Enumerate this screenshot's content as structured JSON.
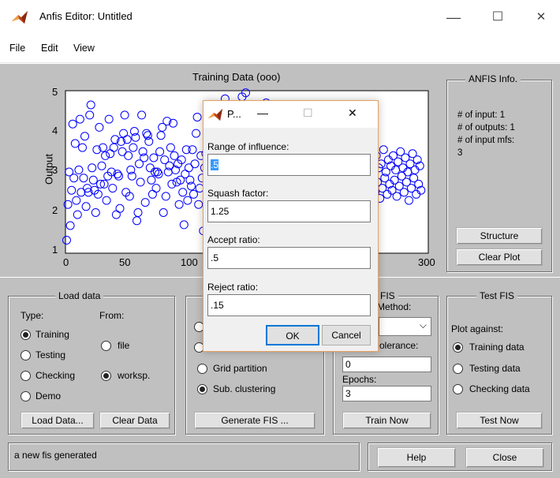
{
  "window": {
    "title": "Anfis Editor: Untitled",
    "minimize": "—",
    "maximize": "☐",
    "close": "✕"
  },
  "menu": {
    "items": [
      "File",
      "Edit",
      "View"
    ]
  },
  "plot": {
    "title": "Training Data (ooo)",
    "ylabel": "Output",
    "xticks": [
      "0",
      "50",
      "100",
      "300"
    ],
    "yticks": [
      "1",
      "2",
      "3",
      "4",
      "5"
    ]
  },
  "chart_data": {
    "type": "scatter",
    "title": "Training Data (ooo)",
    "xlabel": "",
    "ylabel": "Output",
    "xlim": [
      0,
      300
    ],
    "ylim": [
      1,
      5
    ],
    "marker": "o",
    "color": "#0000ff",
    "x": [
      1,
      2,
      3,
      4,
      5,
      6,
      7,
      8,
      9,
      10,
      11,
      12,
      13,
      14,
      15,
      16,
      17,
      18,
      19,
      20,
      21,
      22,
      23,
      24,
      25,
      26,
      27,
      28,
      29,
      30,
      31,
      32,
      33,
      34,
      35,
      36,
      37,
      38,
      39,
      40,
      41,
      42,
      43,
      44,
      45,
      46,
      47,
      48,
      49,
      50,
      51,
      52,
      53,
      54,
      55,
      56,
      57,
      58,
      59,
      60,
      61,
      62,
      63,
      64,
      65,
      66,
      67,
      68,
      69,
      70,
      71,
      72,
      73,
      74,
      75,
      76,
      77,
      78,
      79,
      80,
      81,
      82,
      83,
      84,
      85,
      86,
      87,
      88,
      89,
      90,
      91,
      92,
      93,
      94,
      95,
      96,
      97,
      98,
      99,
      100,
      101,
      102,
      103,
      104,
      105,
      106,
      107,
      108,
      109,
      110,
      111,
      112,
      113,
      114,
      115,
      116,
      117,
      118,
      119,
      120,
      121,
      122,
      123,
      124,
      125,
      126,
      127,
      128,
      129,
      130,
      131,
      132,
      133,
      134,
      135,
      136,
      137,
      138,
      139,
      140,
      141,
      142,
      143,
      144,
      145,
      146,
      147,
      148,
      149,
      150,
      151,
      152,
      153,
      154,
      155,
      156,
      157,
      158,
      159,
      160,
      161,
      162,
      163,
      164,
      165,
      166,
      167,
      168,
      169,
      170,
      171,
      172,
      173,
      174,
      175,
      176,
      177,
      178,
      179,
      180,
      181,
      182,
      183,
      184,
      185,
      186,
      187,
      188,
      189,
      190,
      191,
      192,
      193,
      194,
      195,
      196,
      197,
      198,
      199,
      200,
      201,
      202,
      203,
      204,
      205,
      206,
      207,
      208,
      209,
      210,
      211,
      212,
      213,
      214,
      215,
      216,
      217,
      218,
      219,
      220,
      221,
      222,
      223,
      224,
      225,
      226,
      227,
      228,
      229,
      230,
      231,
      232,
      233,
      234,
      235,
      236,
      237,
      238,
      239,
      240,
      241,
      242,
      243,
      244,
      245,
      246,
      247,
      248,
      249,
      250,
      251,
      252,
      253,
      254,
      255,
      256,
      257,
      258,
      259,
      260,
      261,
      262,
      263,
      264,
      265,
      266,
      267,
      268,
      269,
      270,
      271,
      272,
      273,
      274,
      275,
      276,
      277,
      278,
      279,
      280,
      281,
      282,
      283,
      284,
      285,
      286,
      287,
      288,
      289,
      290,
      291,
      292,
      293,
      294,
      295,
      296,
      297,
      298,
      299,
      300
    ],
    "y": [
      1.32,
      2.2,
      3.0,
      1.68,
      2.55,
      4.18,
      2.85,
      3.7,
      2.3,
      1.95,
      3.05,
      4.3,
      2.5,
      3.6,
      2.85,
      3.88,
      2.15,
      2.6,
      2.5,
      4.4,
      4.65,
      3.1,
      2.8,
      2.55,
      2.0,
      3.55,
      2.45,
      4.1,
      2.7,
      3.15,
      3.6,
      2.7,
      3.4,
      2.3,
      2.9,
      4.3,
      3.45,
      3.0,
      2.6,
      3.6,
      3.8,
      1.95,
      2.95,
      2.9,
      2.1,
      3.75,
      3.5,
      3.95,
      4.4,
      2.5,
      3.8,
      3.4,
      2.4,
      3.05,
      2.9,
      3.6,
      4.0,
      3.85,
      1.8,
      2.0,
      3.2,
      2.75,
      4.4,
      3.5,
      3.35,
      2.25,
      3.95,
      3.9,
      3.75,
      3.1,
      2.8,
      2.45,
      3.35,
      3.0,
      2.6,
      3.0,
      2.95,
      3.5,
      3.9,
      4.1,
      2.0,
      3.3,
      2.4,
      4.25,
      3.0,
      3.15,
      3.6,
      2.7,
      4.2,
      3.4,
      3.05,
      2.75,
      3.2,
      2.2,
      2.8,
      3.3,
      2.5,
      1.7,
      2.95,
      3.55,
      2.3,
      3.1,
      2.8,
      2.65,
      3.55,
      2.45,
      3.2,
      3.95,
      4.35,
      2.2,
      2.6,
      3.4,
      2.85,
      1.55,
      3.1,
      3.45,
      2.35,
      4.5,
      2.9,
      3.2,
      3.75,
      2.55,
      3.0,
      1.6,
      3.65,
      4.45,
      2.75,
      3.05,
      2.25,
      3.9,
      3.35,
      4.8,
      2.45,
      4.3,
      3.6,
      3.1,
      2.0,
      4.6,
      3.8,
      3.25,
      2.7,
      4.1,
      1.75,
      3.5,
      3.0,
      4.85,
      2.5,
      3.7,
      4.95,
      4.2,
      2.85,
      3.4,
      3.95,
      3.2,
      2.35,
      4.55,
      3.75,
      2.95,
      3.6,
      3.3,
      4.0,
      2.65,
      3.85,
      2.2,
      3.1,
      4.7,
      3.45,
      2.8,
      3.25,
      3.0,
      3.55,
      2.75,
      3.15,
      2.4,
      3.9,
      2.9,
      3.35,
      2.6,
      3.7,
      3.05,
      2.5,
      3.25,
      2.1,
      3.45,
      2.85,
      3.6,
      2.3,
      3.0,
      3.8,
      2.55,
      3.2,
      2.7,
      3.5,
      2.95,
      3.35,
      2.45,
      3.1,
      2.8,
      3.65,
      2.25,
      3.0,
      2.65,
      3.4,
      2.9,
      3.15,
      2.5,
      3.55,
      2.75,
      3.05,
      2.35,
      3.3,
      2.6,
      3.75,
      2.85,
      3.2,
      2.45,
      3.5,
      2.95,
      3.1,
      2.7,
      3.35,
      2.55,
      3.0,
      2.8,
      3.45,
      2.4,
      3.15,
      2.65,
      3.6,
      2.9,
      3.25,
      2.5,
      3.4,
      2.75,
      3.05,
      2.3,
      3.2,
      2.6,
      3.5,
      2.85,
      3.1,
      2.45,
      3.35,
      2.7,
      3.0,
      2.55,
      3.3,
      2.8,
      3.15,
      2.4,
      3.45,
      2.65,
      3.05,
      2.9,
      3.25,
      2.5,
      3.4,
      2.75,
      3.1,
      2.35,
      3.2,
      2.6,
      3.55,
      2.85,
      3.0,
      2.45,
      3.3,
      2.7,
      3.15,
      2.55,
      3.4,
      2.8,
      3.05,
      2.4,
      3.25,
      2.65,
      3.5,
      2.9,
      3.1,
      2.5,
      3.35,
      2.75,
      3.0,
      2.3,
      3.2,
      2.6,
      3.45,
      2.85,
      3.05,
      2.45,
      3.3,
      2.7,
      3.15,
      2.55
    ],
    "visible_x_max": 118
  },
  "anfis_info": {
    "title": "ANFIS Info.",
    "lines": [
      "# of input: 1",
      "# of outputs: 1",
      "# of input mfs:",
      "3"
    ],
    "structure_button": "Structure",
    "clear_plot_button": "Clear Plot"
  },
  "load_data": {
    "title": "Load data",
    "type_label": "Type:",
    "from_label": "From:",
    "types": [
      "Training",
      "Testing",
      "Checking",
      "Demo"
    ],
    "type_selected": 0,
    "sources": [
      "file",
      "worksp."
    ],
    "source_selected": 1,
    "load_button": "Load Data...",
    "clear_button": "Clear Data"
  },
  "generate_fis": {
    "options_visible": [
      "Grid partition",
      "Sub. clustering"
    ],
    "selected": 1,
    "button": "Generate FIS ..."
  },
  "train_fis": {
    "title_fragment": "FIS",
    "method_fragment": "Method:",
    "tolerance_fragment": "olerance:",
    "tolerance_value": "0",
    "epochs_label": "Epochs:",
    "epochs_value": "3",
    "button": "Train Now"
  },
  "test_fis": {
    "title": "Test FIS",
    "plot_against_label": "Plot against:",
    "options": [
      "Training data",
      "Testing data",
      "Checking data"
    ],
    "selected": 0,
    "button": "Test Now"
  },
  "status": {
    "text": "a new fis generated"
  },
  "footer": {
    "help_button": "Help",
    "close_button": "Close"
  },
  "dialog": {
    "title": "P...",
    "minimize": "—",
    "maximize": "☐",
    "close": "✕",
    "fields": [
      {
        "label": "Range of influence:",
        "value": ".5"
      },
      {
        "label": "Squash factor:",
        "value": "1.25"
      },
      {
        "label": "Accept ratio:",
        "value": ".5"
      },
      {
        "label": "Reject ratio:",
        "value": ".15"
      }
    ],
    "ok_button": "OK",
    "cancel_button": "Cancel"
  }
}
